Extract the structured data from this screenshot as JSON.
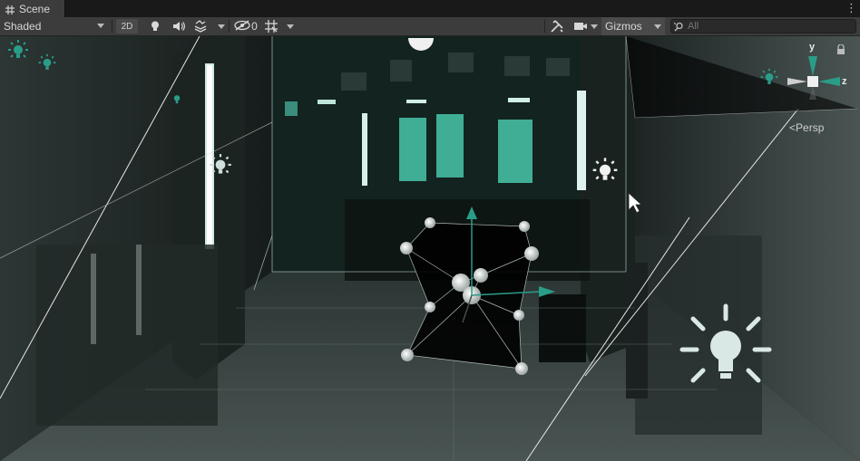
{
  "tab": {
    "title": "Scene",
    "icon": "grid-icon",
    "menu_icon": "kebab-icon"
  },
  "toolbar": {
    "draw_mode": "Shaded",
    "mode_2d": "2D",
    "hidden_count": "0",
    "gizmos_label": "Gizmos"
  },
  "search": {
    "placeholder": "All",
    "value": ""
  },
  "scene_gizmo": {
    "axis_y": "y",
    "axis_z": "z",
    "projection": "Persp"
  },
  "colors": {
    "accent_teal": "#2a9d88",
    "axis_gray": "#cfcfcf",
    "toolbar_bg": "#3c3c3c"
  }
}
